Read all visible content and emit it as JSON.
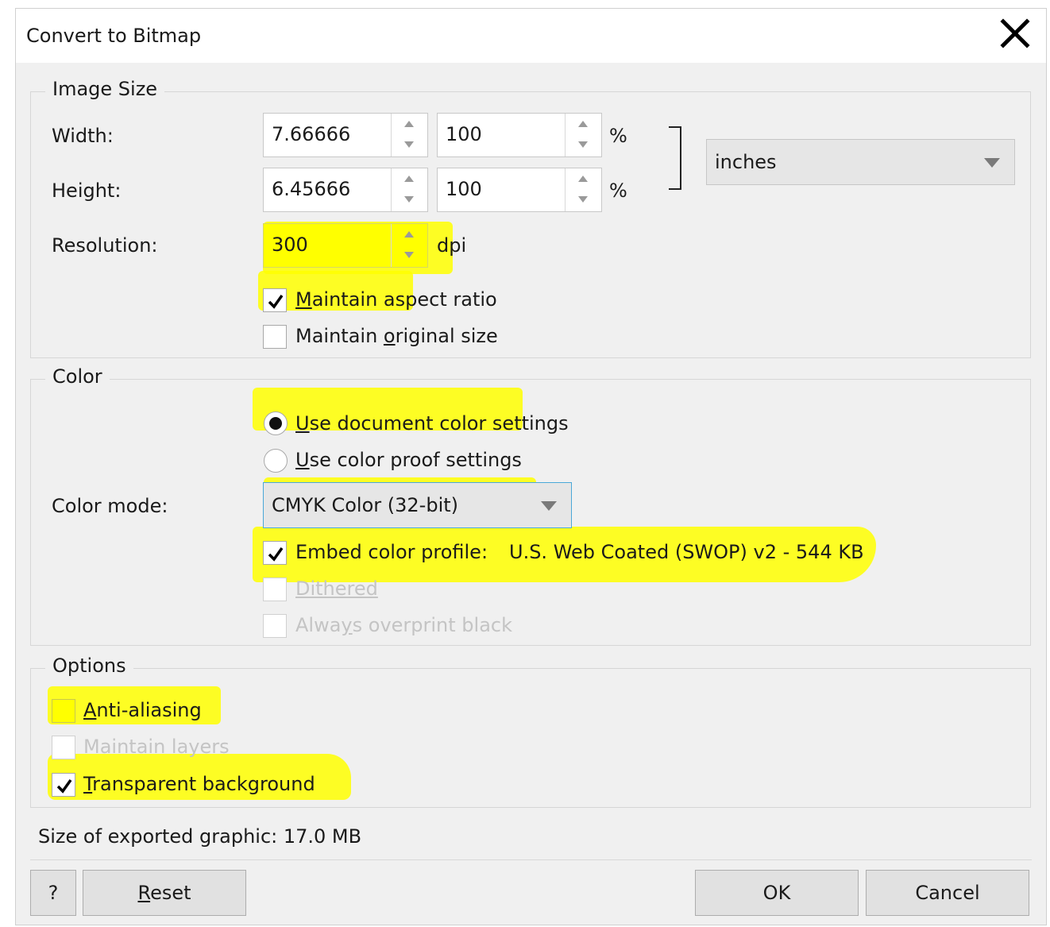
{
  "window": {
    "title": "Convert to Bitmap"
  },
  "image_size": {
    "legend": "Image Size",
    "width_label": "Width:",
    "width_value": "7.66666",
    "width_percent": "100",
    "height_label": "Height:",
    "height_value": "6.45666",
    "height_percent": "100",
    "percent_unit": "%",
    "units_value": "inches",
    "resolution_label": "Resolution:",
    "resolution_value": "300",
    "resolution_unit": "dpi",
    "maintain_aspect_u": "M",
    "maintain_aspect_rest": "aintain aspect ratio",
    "maintain_aspect_checked": true,
    "maintain_original_a": "Maintain ",
    "maintain_original_u": "o",
    "maintain_original_b": "riginal size",
    "maintain_original_checked": false
  },
  "color": {
    "legend": "Color",
    "use_document_u": "U",
    "use_document_rest": "se document color settings",
    "use_document_selected": true,
    "use_proof_u": "U",
    "use_proof_rest": "se color proof settings",
    "color_mode_label": "Color mode:",
    "color_mode_value": "CMYK Color (32-bit)",
    "embed_profile_label": "Embed color profile:",
    "embed_profile_value": "U.S. Web Coated (SWOP) v2 - 544 KB",
    "embed_profile_checked": true,
    "dithered_label": "Dithered",
    "overprint_a": "Alwa",
    "overprint_u": "y",
    "overprint_b": "s overprint black"
  },
  "options": {
    "legend": "Options",
    "anti_aliasing_u": "A",
    "anti_aliasing_rest": "nti-aliasing",
    "anti_aliasing_checked": false,
    "maintain_layers": "Maintain layers",
    "transparent_u": "T",
    "transparent_rest": "ransparent background",
    "transparent_checked": true
  },
  "footer": {
    "size_text": "Size of exported graphic: 17.0 MB",
    "help_label": "?",
    "reset_u": "R",
    "reset_rest": "eset",
    "ok_label": "OK",
    "cancel_label": "Cancel"
  },
  "colors": {
    "highlight": "#ffff00",
    "dialog_bg": "#f0f0f0",
    "focus_border": "#4aa8d8"
  }
}
